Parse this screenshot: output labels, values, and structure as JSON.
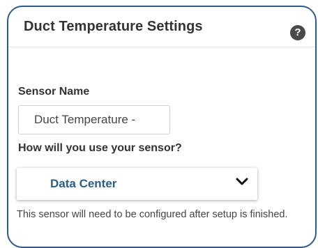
{
  "panel": {
    "title": "Duct Temperature Settings",
    "help_icon": "question-circle-icon",
    "help_glyph": "?"
  },
  "form": {
    "sensor_name": {
      "label": "Sensor Name",
      "value": "Duct Temperature -"
    },
    "usage": {
      "label": "How will you use your sensor?",
      "selected": "Data Center",
      "icon": "chevron-down-icon"
    },
    "note": "This sensor will need to be configured after setup is finished."
  },
  "colors": {
    "panel_border": "#2e5a8a",
    "select_text": "#2a5d87",
    "help_bg": "#4a4a4a"
  }
}
